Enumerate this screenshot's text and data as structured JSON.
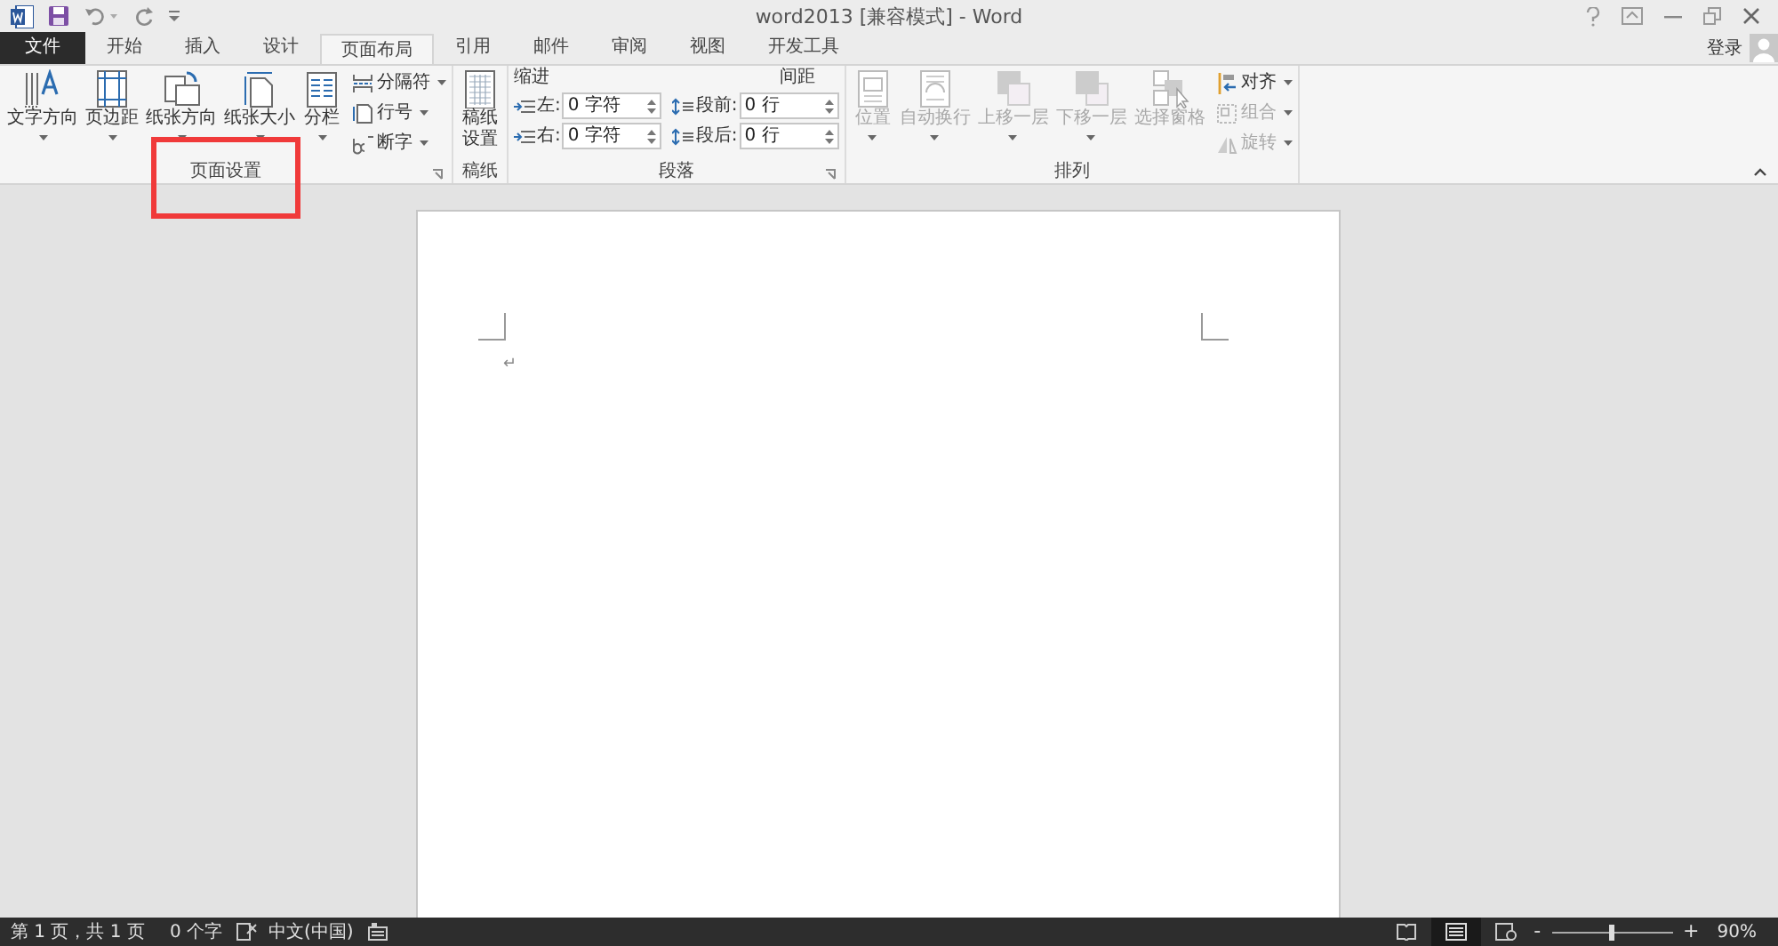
{
  "window": {
    "title": "word2013 [兼容模式] - Word"
  },
  "tabs": [
    {
      "label": "文件",
      "kind": "file",
      "selected": false
    },
    {
      "label": "开始",
      "kind": "tab",
      "selected": false
    },
    {
      "label": "插入",
      "kind": "tab",
      "selected": false
    },
    {
      "label": "设计",
      "kind": "tab",
      "selected": false
    },
    {
      "label": "页面布局",
      "kind": "tab",
      "selected": true
    },
    {
      "label": "引用",
      "kind": "tab",
      "selected": false
    },
    {
      "label": "邮件",
      "kind": "tab",
      "selected": false
    },
    {
      "label": "审阅",
      "kind": "tab",
      "selected": false
    },
    {
      "label": "视图",
      "kind": "tab",
      "selected": false
    },
    {
      "label": "开发工具",
      "kind": "tab",
      "selected": false
    }
  ],
  "account": {
    "label": "登录"
  },
  "ribbon": {
    "groups": [
      {
        "kind": "buttons",
        "label": "页面设置",
        "highlighted": true,
        "launcher": true,
        "large_buttons": [
          {
            "label": "文字方向",
            "dropdown": true,
            "disabled": false
          },
          {
            "label": "页边距",
            "dropdown": true,
            "disabled": false
          },
          {
            "label": "纸张方向",
            "dropdown": true,
            "disabled": false
          },
          {
            "label": "纸张大小",
            "dropdown": true,
            "disabled": false
          },
          {
            "label": "分栏",
            "dropdown": true,
            "disabled": false
          }
        ],
        "small_buttons": [
          {
            "label": "分隔符",
            "disabled": false
          },
          {
            "label": "行号",
            "disabled": false
          },
          {
            "label": "断字",
            "disabled": false
          }
        ]
      },
      {
        "kind": "buttons",
        "label": "稿纸",
        "highlighted": false,
        "launcher": false,
        "large_buttons": [
          {
            "label": "稿纸设置",
            "dropdown": false,
            "disabled": false
          }
        ]
      },
      {
        "kind": "paragraph",
        "label": "段落",
        "highlighted": false,
        "launcher": true,
        "columns": [
          {
            "heading": "缩进",
            "fields": [
              {
                "label": "左:",
                "value": "0 字符"
              },
              {
                "label": "右:",
                "value": "0 字符"
              }
            ]
          },
          {
            "heading": "间距",
            "fields": [
              {
                "label": "段前:",
                "value": "0 行"
              },
              {
                "label": "段后:",
                "value": "0 行"
              }
            ]
          }
        ]
      },
      {
        "kind": "buttons",
        "label": "排列",
        "highlighted": false,
        "launcher": false,
        "large_buttons": [
          {
            "label": "位置",
            "dropdown": true,
            "disabled": true
          },
          {
            "label": "自动换行",
            "dropdown": true,
            "disabled": true
          },
          {
            "label": "上移一层",
            "dropdown": true,
            "disabled": true
          },
          {
            "label": "下移一层",
            "dropdown": true,
            "disabled": true
          },
          {
            "label": "选择窗格",
            "dropdown": false,
            "disabled": true
          }
        ],
        "small_buttons": [
          {
            "label": "对齐",
            "disabled": false
          },
          {
            "label": "组合",
            "disabled": true
          },
          {
            "label": "旋转",
            "disabled": true
          }
        ]
      }
    ]
  },
  "document": {
    "paragraph_mark": "↵"
  },
  "status_bar": {
    "items": [
      "第 1 页，共 1 页",
      "0 个字",
      "中文(中国)"
    ],
    "zoom": {
      "zoom_out": "-",
      "level": 0.47,
      "zoom_in": "+",
      "reading": "90%"
    }
  }
}
